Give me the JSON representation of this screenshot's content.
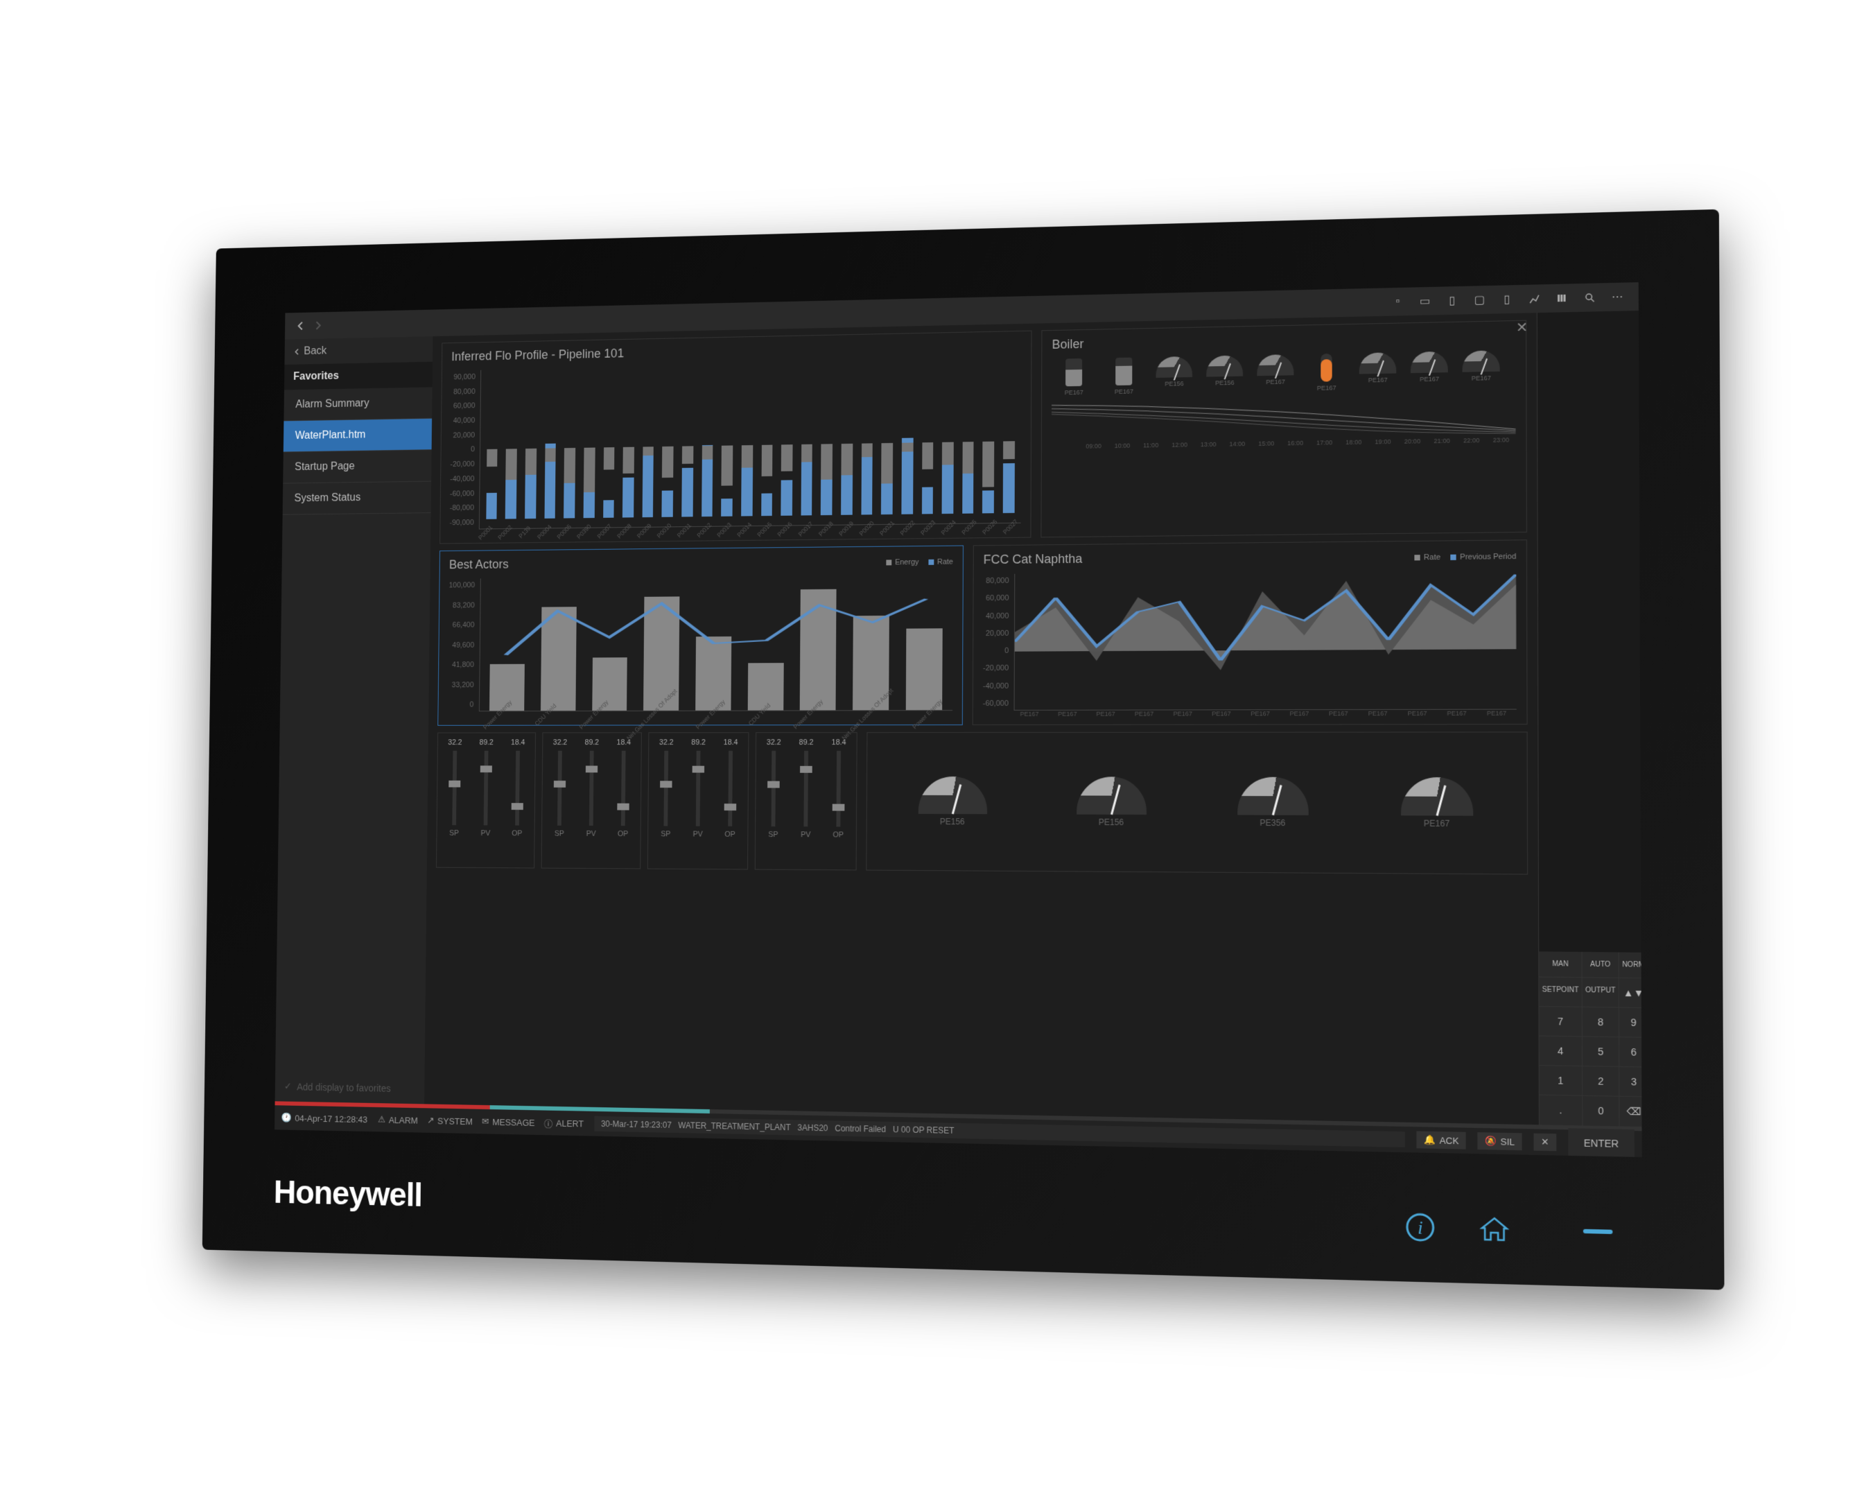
{
  "brand": "Honeywell",
  "nav": {
    "back_label": "Back",
    "sidebar_heading": "Favorites",
    "items": [
      {
        "label": "Alarm Summary",
        "active": false
      },
      {
        "label": "WaterPlant.htm",
        "active": true
      },
      {
        "label": "Startup Page",
        "active": false
      },
      {
        "label": "System Status",
        "active": false
      }
    ],
    "add_favorites": "Add display to favorites"
  },
  "panels": {
    "flo": {
      "title": "Inferred Flo Profile - Pipeline 101",
      "y_ticks": [
        "90,000",
        "80,000",
        "60,000",
        "40,000",
        "20,000",
        "0",
        "-20,000",
        "-40,000",
        "-60,000",
        "-80,000",
        "-90,000"
      ]
    },
    "boiler": {
      "title": "Boiler",
      "gauges": [
        "PE167",
        "PE167",
        "PE156",
        "PE156",
        "PE167",
        "PE167",
        "PE167",
        "PE167",
        "PE167"
      ],
      "time_ticks": [
        "09:00",
        "10:00",
        "11:00",
        "12:00",
        "13:00",
        "14:00",
        "15:00",
        "16:00",
        "17:00",
        "18:00",
        "19:00",
        "20:00",
        "21:00",
        "22:00",
        "23:00"
      ]
    },
    "actors": {
      "title": "Best Actors",
      "legend": [
        {
          "label": "Energy",
          "color": "#888"
        },
        {
          "label": "Rate",
          "color": "#5a8fc7"
        }
      ],
      "y_ticks": [
        "100,000",
        "83,200",
        "66,400",
        "49,600",
        "41,800",
        "33,200",
        "0"
      ],
      "x_labels": [
        "Power Energy",
        "CDU Yield",
        "Power Energy",
        "Net Gas Losses Of Adopt",
        "Power Energy",
        "CDU Yield",
        "Power Energy",
        "Net Gas Losses Of Adopt",
        "Power Energy"
      ]
    },
    "naphtha": {
      "title": "FCC Cat Naphtha",
      "legend": [
        {
          "label": "Rate",
          "color": "#888"
        },
        {
          "label": "Previous Period",
          "color": "#5a8fc7"
        }
      ],
      "y_ticks": [
        "80,000",
        "60,000",
        "40,000",
        "20,000",
        "0",
        "-20,000",
        "-40,000",
        "-60,000"
      ],
      "x_labels": [
        "PE167",
        "PE167",
        "PE167",
        "PE167",
        "PE167",
        "PE167",
        "PE167",
        "PE167",
        "PE167",
        "PE167",
        "PE167",
        "PE167",
        "PE167"
      ]
    }
  },
  "sliders": {
    "groups": [
      [
        {
          "v": "32.2",
          "l": "SP",
          "p": 40
        },
        {
          "v": "89.2",
          "l": "PV",
          "p": 20
        },
        {
          "v": "18.4",
          "l": "OP",
          "p": 70
        }
      ],
      [
        {
          "v": "32.2",
          "l": "SP",
          "p": 40
        },
        {
          "v": "89.2",
          "l": "PV",
          "p": 20
        },
        {
          "v": "18.4",
          "l": "OP",
          "p": 70
        }
      ],
      [
        {
          "v": "32.2",
          "l": "SP",
          "p": 40
        },
        {
          "v": "89.2",
          "l": "PV",
          "p": 20
        },
        {
          "v": "18.4",
          "l": "OP",
          "p": 70
        }
      ],
      [
        {
          "v": "32.2",
          "l": "SP",
          "p": 40
        },
        {
          "v": "89.2",
          "l": "PV",
          "p": 20
        },
        {
          "v": "18.4",
          "l": "OP",
          "p": 70
        }
      ]
    ]
  },
  "gauges_large": [
    "PE156",
    "PE156",
    "PE356",
    "PE167"
  ],
  "keypad": {
    "modes": [
      "MAN",
      "AUTO",
      "NORM"
    ],
    "labels": [
      "SETPOINT",
      "OUTPUT"
    ],
    "nums": [
      "7",
      "8",
      "9",
      "4",
      "5",
      "6",
      "1",
      "2",
      "3",
      ".",
      "0"
    ],
    "enter": "ENTER"
  },
  "statusbar": {
    "datetime": "04-Apr-17 12:28:43",
    "items": [
      "ALARM",
      "SYSTEM",
      "MESSAGE",
      "ALERT"
    ],
    "message": {
      "ts": "30-Mar-17  19:23:07",
      "src": "WATER_TREATMENT_PLANT",
      "tag": "3AHS20",
      "txt": "Control Failed",
      "extra": "U 00 OP  RESET"
    },
    "ack": "ACK",
    "sil": "SIL"
  },
  "chart_data": [
    {
      "type": "bar",
      "title": "Inferred Flo Profile - Pipeline 101",
      "ylim": [
        -90000,
        90000
      ],
      "categories": [
        "P0001",
        "P0002",
        "P139",
        "P0004",
        "P0005",
        "P0390",
        "P0007",
        "P0008",
        "P0009",
        "P0010",
        "P0011",
        "P0012",
        "P0013",
        "P0014",
        "P0015",
        "P0016",
        "P0017",
        "P0018",
        "P0019",
        "P0020",
        "P0021",
        "P0022",
        "P0023",
        "P0024",
        "P0025",
        "P0026",
        "P0027"
      ],
      "series": [
        {
          "name": "positive",
          "values": [
            30000,
            50000,
            55000,
            85000,
            60000,
            35000,
            20000,
            45000,
            75000,
            30000,
            55000,
            80000,
            20000,
            60000,
            25000,
            40000,
            65000,
            55000,
            50000,
            70000,
            35000,
            85000,
            30000,
            60000,
            45000,
            25000,
            55000
          ]
        },
        {
          "name": "negative",
          "values": [
            -20000,
            -35000,
            -30000,
            -15000,
            -40000,
            -50000,
            -25000,
            -30000,
            -10000,
            -35000,
            -20000,
            -15000,
            -45000,
            -25000,
            -35000,
            -30000,
            -20000,
            -40000,
            -35000,
            -15000,
            -45000,
            -10000,
            -30000,
            -25000,
            -35000,
            -50000,
            -20000
          ]
        }
      ]
    },
    {
      "type": "bar",
      "title": "Best Actors",
      "ylim": [
        0,
        100000
      ],
      "categories": [
        "Power Energy",
        "CDU Yield",
        "Power Energy",
        "Net Gas Losses",
        "Power Energy",
        "CDU Yield",
        "Power Energy",
        "Net Gas Losses",
        "Power Energy"
      ],
      "series": [
        {
          "name": "Energy",
          "values": [
            35000,
            78000,
            40000,
            85000,
            55000,
            35000,
            90000,
            70000,
            60000
          ]
        },
        {
          "name": "Rate",
          "values": [
            42000,
            75000,
            55000,
            80000,
            50000,
            52000,
            78000,
            65000,
            82000
          ]
        }
      ]
    },
    {
      "type": "area",
      "title": "FCC Cat Naphtha",
      "ylim": [
        -60000,
        80000
      ],
      "x": [
        "PE167",
        "PE167",
        "PE167",
        "PE167",
        "PE167",
        "PE167",
        "PE167",
        "PE167",
        "PE167",
        "PE167",
        "PE167",
        "PE167",
        "PE167"
      ],
      "series": [
        {
          "name": "Rate",
          "values": [
            20000,
            45000,
            -10000,
            55000,
            30000,
            -20000,
            60000,
            15000,
            70000,
            -5000,
            50000,
            25000,
            65000
          ]
        },
        {
          "name": "Previous Period",
          "values": [
            10000,
            55000,
            5000,
            40000,
            50000,
            -10000,
            45000,
            30000,
            60000,
            10000,
            65000,
            35000,
            75000
          ]
        }
      ]
    }
  ]
}
